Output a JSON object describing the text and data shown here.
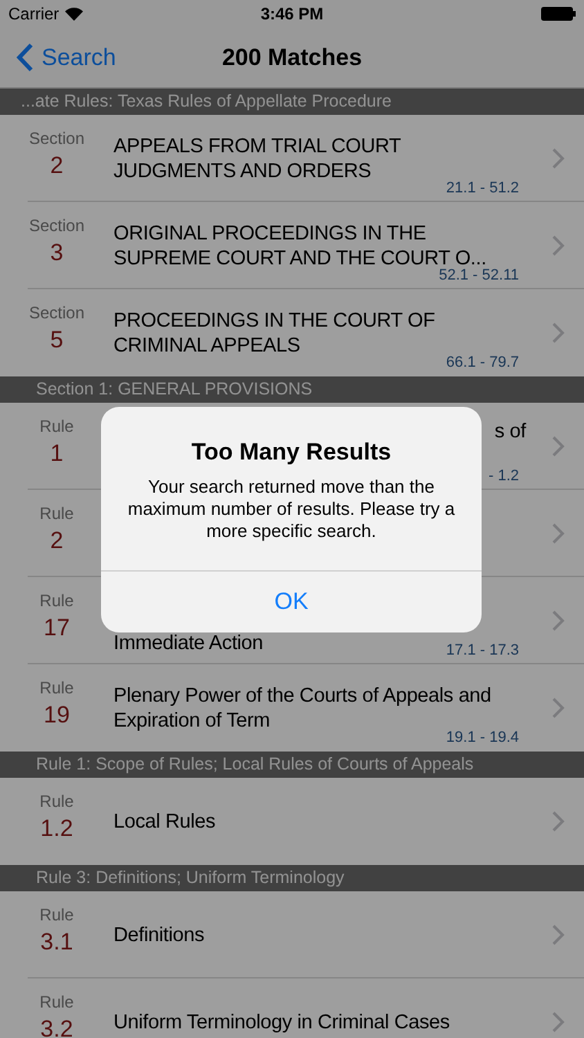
{
  "status_bar": {
    "carrier": "Carrier",
    "time": "3:46 PM"
  },
  "nav": {
    "back": "Search",
    "title": "200 Matches"
  },
  "groups": [
    {
      "header": "...ate Rules: Texas Rules of Appellate Procedure",
      "rows": [
        {
          "kind": "full",
          "label": "Section",
          "number": "2",
          "title": "APPEALS FROM TRIAL COURT JUDGMENTS AND ORDERS",
          "range": "21.1 - 51.2"
        },
        {
          "kind": "full",
          "label": "Section",
          "number": "3",
          "title": "ORIGINAL PROCEEDINGS IN THE SUPREME COURT AND THE COURT O...",
          "range": "52.1 - 52.11"
        },
        {
          "kind": "full",
          "label": "Section",
          "number": "5",
          "title": "PROCEEDINGS IN THE COURT OF CRIMINAL APPEALS",
          "range": "66.1 - 79.7"
        }
      ]
    },
    {
      "header": "Section 1: GENERAL PROVISIONS",
      "rows": [
        {
          "kind": "head",
          "label": "Rule",
          "number": "1",
          "title": "s of",
          "range": "- 1.2"
        },
        {
          "kind": "hidden",
          "label": "Rule",
          "number": "2"
        },
        {
          "kind": "tail",
          "label": "Rule",
          "number": "17",
          "title": "Immediate Action",
          "range": "17.1 - 17.3"
        },
        {
          "kind": "full",
          "label": "Rule",
          "number": "19",
          "title": "Plenary Power of the Courts of Appeals and Expiration of Term",
          "range": "19.1 - 19.4"
        }
      ]
    },
    {
      "header": "Rule 1: Scope of Rules; Local Rules of Courts of Appeals",
      "rows": [
        {
          "kind": "full",
          "label": "Rule",
          "number": "1.2",
          "title": "Local Rules"
        }
      ]
    },
    {
      "header": "Rule 3: Definitions; Uniform Terminology",
      "rows": [
        {
          "kind": "full",
          "label": "Rule",
          "number": "3.1",
          "title": "Definitions"
        },
        {
          "kind": "full",
          "label": "Rule",
          "number": "3.2",
          "title": "Uniform Terminology in Criminal Cases"
        }
      ]
    }
  ],
  "alert": {
    "title": "Too Many Results",
    "message": "Your search returned move than the maximum number of results. Please try a more specific search.",
    "button": "OK"
  }
}
